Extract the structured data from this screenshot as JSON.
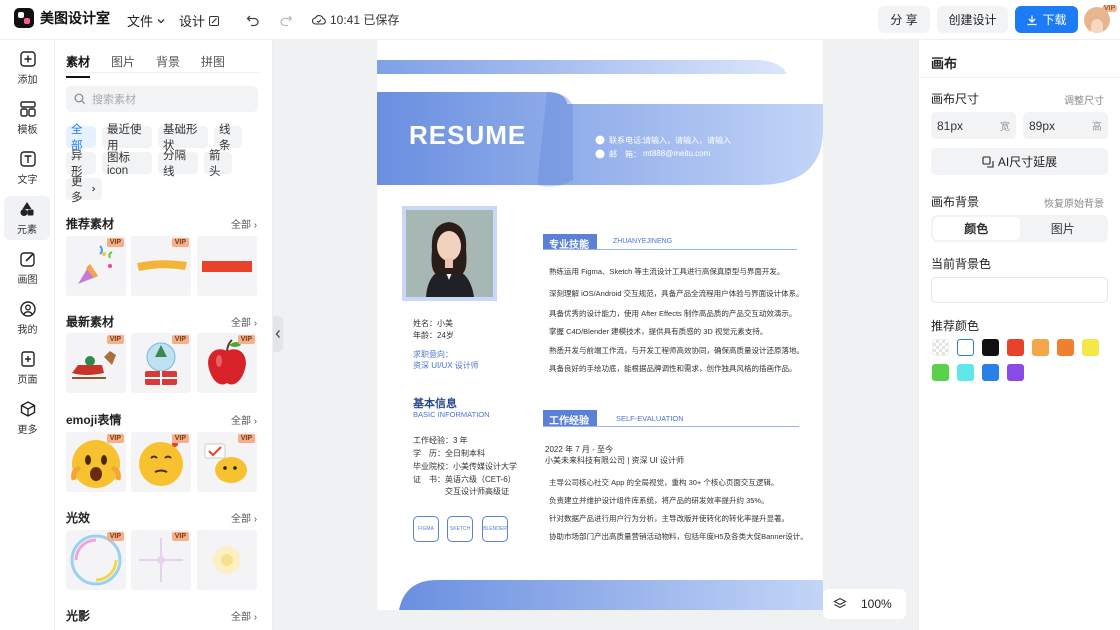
{
  "app": {
    "name": "美图设计室"
  },
  "menu": {
    "file": "文件",
    "design": "设计",
    "save_status": "10:41 已保存"
  },
  "actions": {
    "share": "分 享",
    "create": "创建设计",
    "download": "下载",
    "vip_badge": "VIP"
  },
  "rail": [
    {
      "label": "添加",
      "icon": "plus-square-icon"
    },
    {
      "label": "模板",
      "icon": "template-icon"
    },
    {
      "label": "文字",
      "icon": "text-icon"
    },
    {
      "label": "元素",
      "icon": "shapes-icon"
    },
    {
      "label": "画图",
      "icon": "draw-icon"
    },
    {
      "label": "我的",
      "icon": "user-icon"
    },
    {
      "label": "页面",
      "icon": "page-add-icon"
    },
    {
      "label": "更多",
      "icon": "cube-icon"
    }
  ],
  "panel": {
    "tabs": [
      "素材",
      "图片",
      "背景",
      "拼图"
    ],
    "search_placeholder": "搜索素材",
    "chips": [
      "全部",
      "最近使用",
      "基础形状",
      "线条",
      "异形",
      "图标icon",
      "分隔线",
      "箭头",
      "更多"
    ],
    "all_label": "全部",
    "sections": [
      {
        "title": "推荐素材"
      },
      {
        "title": "最新素材"
      },
      {
        "title": "emoji表情"
      },
      {
        "title": "光效"
      },
      {
        "title": "光影"
      }
    ]
  },
  "canvas": {
    "zoom": "100%"
  },
  "resume": {
    "title": "RESUME",
    "contact_label_1": "联系电话：",
    "contact_value_1": "请输入，请输入，请输入",
    "contact_label_2": "邮　箱：",
    "contact_value_2": "mt888@meitu.com",
    "name_line": "姓名：小美",
    "age_line": "年龄：24岁",
    "intent_label": "求职意向：",
    "intent_value": "资深 UI/UX 设计师",
    "basic_title": "基本信息",
    "basic_sub": "BASIC INFORMATION",
    "basic_lines": [
      "工作经验：3 年",
      "学　历：全日制本科",
      "毕业院校：小美传媒设计大学",
      "证　书：英语六级（CET-6）",
      "　　　　交互设计师高级证"
    ],
    "tags": [
      "FIGMA",
      "SKETCH",
      "BLENDER"
    ],
    "skills_title": "专业技能",
    "skills_sub": "ZHUANYEJINENG",
    "skills": [
      "熟练运用 Figma、Sketch 等主流设计工具进行高保真原型与界面开发。",
      "深刻理解 iOS/Android 交互规范，具备产品全流程用户体验与界面设计体系。",
      "具备优秀的设计能力，使用 After Effects 制作高品质的产品交互动效演示。",
      "掌握 C4D/Blender 建模技术，提供具有质感的 3D 视觉元素支持。",
      "熟悉开发与前端工作流，与开发工程师高效协同，确保高质量设计还原落地。",
      "具备良好的手绘功底，能根据品牌调性和需求，创作独具风格的插画作品。"
    ],
    "work_title": "工作经验",
    "work_sub": "SELF-EVALUATION",
    "work_date": "2022 年 7 月 - 至今",
    "work_company": "小美未来科技有限公司 | 资深 UI 设计师",
    "work_items": [
      "主导公司核心社交 App 的全局视觉，重构 30+ 个核心页面交互逻辑。",
      "负责建立并维护设计组件库系统，将产品的研发效率提升约 35%。",
      "针对数据产品进行用户行为分析，主导改版并使转化的转化率提升显著。",
      "协助市场部门产出高质量营销活动物料，包括年度H5及各类大促Banner设计。"
    ]
  },
  "right": {
    "title": "画布",
    "size_label": "画布尺寸",
    "adjust_label": "调整尺寸",
    "width_value": "81px",
    "width_unit": "宽",
    "height_value": "89px",
    "height_unit": "高",
    "ai_expand": "AI尺寸延展",
    "bg_label": "画布背景",
    "restore_label": "恢复原始背景",
    "seg_color": "颜色",
    "seg_image": "图片",
    "current_bg_label": "当前背景色",
    "recommend_label": "推荐颜色",
    "colors": [
      "transparent",
      "#ffffff",
      "#111111",
      "#e8432a",
      "#f3a64a",
      "#f08030",
      "#f7e84a",
      "#5ad14a",
      "#5ee8ea",
      "#2b7fe8",
      "#8a4ae8"
    ]
  }
}
